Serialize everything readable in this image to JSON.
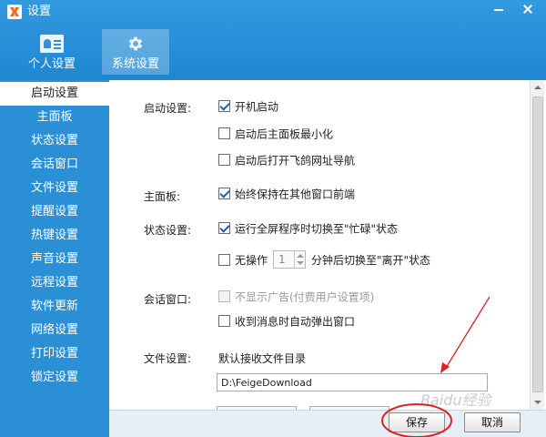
{
  "window": {
    "title": "设置"
  },
  "tabs": [
    {
      "label": "个人设置",
      "icon": "id-card-icon"
    },
    {
      "label": "系统设置",
      "icon": "gear-icon",
      "active": true
    }
  ],
  "sidebar": {
    "items": [
      {
        "label": "启动设置",
        "active": true
      },
      {
        "label": "主面板"
      },
      {
        "label": "状态设置"
      },
      {
        "label": "会话窗口"
      },
      {
        "label": "文件设置"
      },
      {
        "label": "提醒设置"
      },
      {
        "label": "热键设置"
      },
      {
        "label": "声音设置"
      },
      {
        "label": "远程设置"
      },
      {
        "label": "软件更新"
      },
      {
        "label": "网络设置"
      },
      {
        "label": "打印设置"
      },
      {
        "label": "锁定设置"
      }
    ]
  },
  "sections": {
    "startup": {
      "label": "启动设置:",
      "options": [
        {
          "label": "开机启动",
          "checked": true
        },
        {
          "label": "启动后主面板最小化",
          "checked": false
        },
        {
          "label": "启动后打开飞鸽网址导航",
          "checked": false
        }
      ]
    },
    "main_panel": {
      "label": "主面板:",
      "options": [
        {
          "label": "始终保持在其他窗口前端",
          "checked": true
        }
      ]
    },
    "status": {
      "label": "状态设置:",
      "options": [
        {
          "label": "运行全屏程序时切换至\"忙碌\"状态",
          "checked": true
        }
      ],
      "idle": {
        "label_before": "无操作",
        "minutes": "1",
        "label_after": "分钟后切换至\"离开\"状态",
        "checked": false
      }
    },
    "chat": {
      "label": "会话窗口:",
      "options": [
        {
          "label": "不显示广告(付费用户设置项)",
          "checked": false,
          "disabled": true
        },
        {
          "label": "收到消息时自动弹出窗口",
          "checked": false
        }
      ]
    },
    "file": {
      "label": "文件设置:",
      "receive_dir_label": "默认接收文件目录",
      "receive_dir_value": "D:\\FeigeDownload"
    }
  },
  "footer": {
    "save_label": "保存",
    "cancel_label": "取消"
  },
  "annotation": {
    "color": "#e02020"
  },
  "watermark": "Baidu经验"
}
